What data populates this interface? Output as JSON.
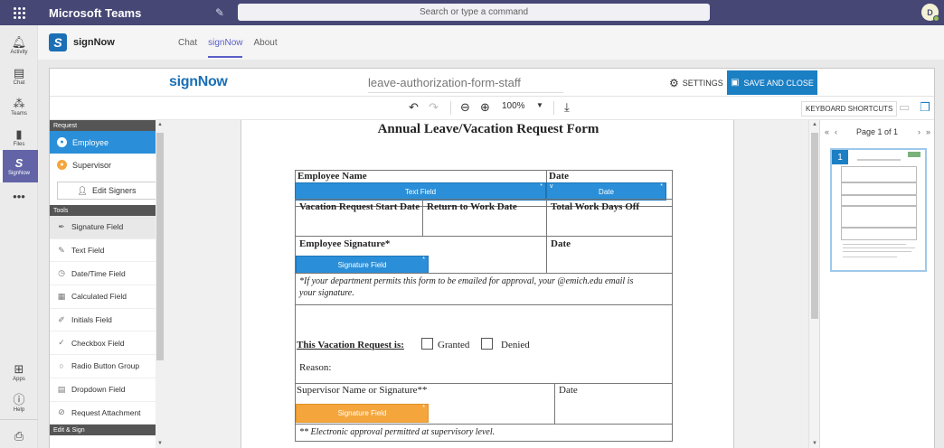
{
  "teams": {
    "app_name": "Microsoft Teams",
    "search_placeholder": "Search or type a command",
    "avatar_initial": "D"
  },
  "rail": [
    {
      "label": "Activity",
      "icon": "bell-icon"
    },
    {
      "label": "Chat",
      "icon": "chat-icon"
    },
    {
      "label": "Teams",
      "icon": "teams-icon"
    },
    {
      "label": "Files",
      "icon": "files-icon"
    },
    {
      "label": "SignNow",
      "icon": "signnow-icon"
    },
    {
      "label": "",
      "icon": "more-icon"
    },
    {
      "label": "Apps",
      "icon": "apps-icon"
    },
    {
      "label": "Help",
      "icon": "help-icon"
    },
    {
      "label": "",
      "icon": "download-icon"
    }
  ],
  "app_header": {
    "title": "signNow",
    "tabs": [
      "Chat",
      "signNow",
      "About"
    ],
    "active_tab": "signNow"
  },
  "sn_bar": {
    "brand": "signNow",
    "document_name": "leave-authorization-form-staff",
    "settings_label": "SETTINGS",
    "save_label": "SAVE AND CLOSE"
  },
  "toolbar": {
    "zoom": "100%",
    "keyboard_shortcuts": "KEYBOARD SHORTCUTS"
  },
  "side": {
    "request_header": "Request",
    "roles": [
      {
        "label": "Employee",
        "color": "#2a8fd8"
      },
      {
        "label": "Supervisor",
        "color": "#f4a63c"
      }
    ],
    "edit_signers": "Edit Signers",
    "tools_header": "Tools",
    "tools": [
      {
        "label": "Signature Field",
        "icon": "pen-icon"
      },
      {
        "label": "Text Field",
        "icon": "text-icon"
      },
      {
        "label": "Date/Time Field",
        "icon": "clock-icon"
      },
      {
        "label": "Calculated Field",
        "icon": "calculator-icon"
      },
      {
        "label": "Initials Field",
        "icon": "initials-icon"
      },
      {
        "label": "Checkbox Field",
        "icon": "check-icon"
      },
      {
        "label": "Radio Button Group",
        "icon": "radio-icon"
      },
      {
        "label": "Dropdown Field",
        "icon": "dropdown-icon"
      },
      {
        "label": "Request Attachment",
        "icon": "attachment-icon"
      }
    ],
    "edit_sign_header": "Edit & Sign"
  },
  "form": {
    "title": "Annual Leave/Vacation Request Form",
    "employee_name": "Employee Name",
    "date": "Date",
    "text_field": "Text Field",
    "date_field": "Date",
    "vacation_start": "Vacation Request Start Date",
    "return_to_work": "Return to Work Date",
    "total_days": "Total Work Days Off",
    "employee_signature": "Employee Signature*",
    "date2": "Date",
    "signature_field": "Signature Field",
    "note_line1": "*If your department permits this form to be emailed for approval, your @emich.edu email is",
    "note_line2": "your signature.",
    "vacation_request_is": "This Vacation Request is:",
    "granted": "Granted",
    "denied": "Denied",
    "reason": "Reason:",
    "supervisor_label": "Supervisor Name or Signature**",
    "date3": "Date",
    "supervisor_field": "Signature Field",
    "electronic_note": "** Electronic approval permitted at supervisory level."
  },
  "thumbs": {
    "page_label": "Page 1 of 1",
    "page_number": "1"
  }
}
